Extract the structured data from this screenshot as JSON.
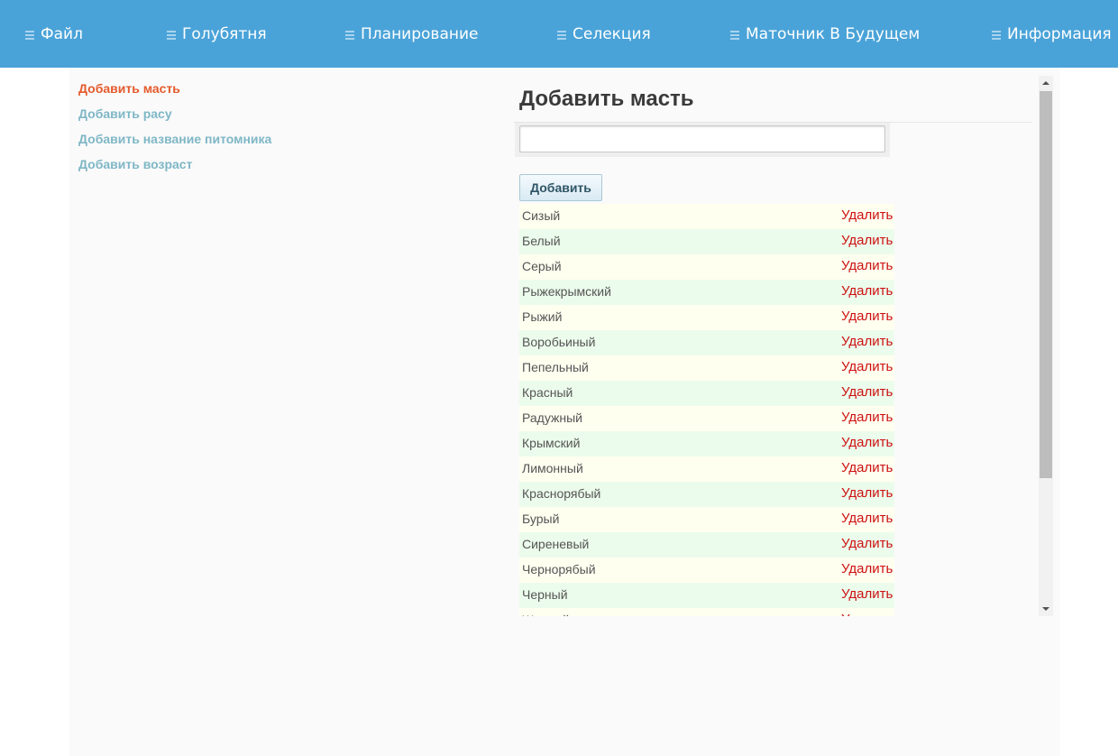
{
  "top_menu": {
    "items": [
      {
        "label": "Файл",
        "icon": "menu-lines-icon"
      },
      {
        "label": "Голубятня",
        "icon": "menu-lines-icon"
      },
      {
        "label": "Планирование",
        "icon": "menu-lines-icon"
      },
      {
        "label": "Селекция",
        "icon": "menu-lines-icon"
      },
      {
        "label": "Маточник В Будущем",
        "icon": "menu-lines-icon"
      },
      {
        "label": "Информация",
        "icon": "menu-lines-icon"
      }
    ],
    "bg_color": "#4aa3d8"
  },
  "sidebar": {
    "items": [
      {
        "label": "Добавить масть",
        "active": true
      },
      {
        "label": "Добавить расу",
        "active": false
      },
      {
        "label": "Добавить название питомника",
        "active": false
      },
      {
        "label": "Добавить возраст",
        "active": false
      }
    ],
    "active_color": "#e45a2c",
    "link_color": "#7fb7c6"
  },
  "main": {
    "title": "Добавить масть",
    "input": {
      "value": "",
      "placeholder": ""
    },
    "add_button_label": "Добавить",
    "delete_label": "Удалить",
    "rows": [
      "Сизый",
      "Белый",
      "Серый",
      "Рыжекрымский",
      "Рыжий",
      "Воробьиный",
      "Пепельный",
      "Красный",
      "Радужный",
      "Крымский",
      "Лимонный",
      "Краснорябый",
      "Бурый",
      "Сиреневый",
      "Чернорябый",
      "Черный",
      "Желтый"
    ],
    "delete_color": "#cc1111"
  }
}
